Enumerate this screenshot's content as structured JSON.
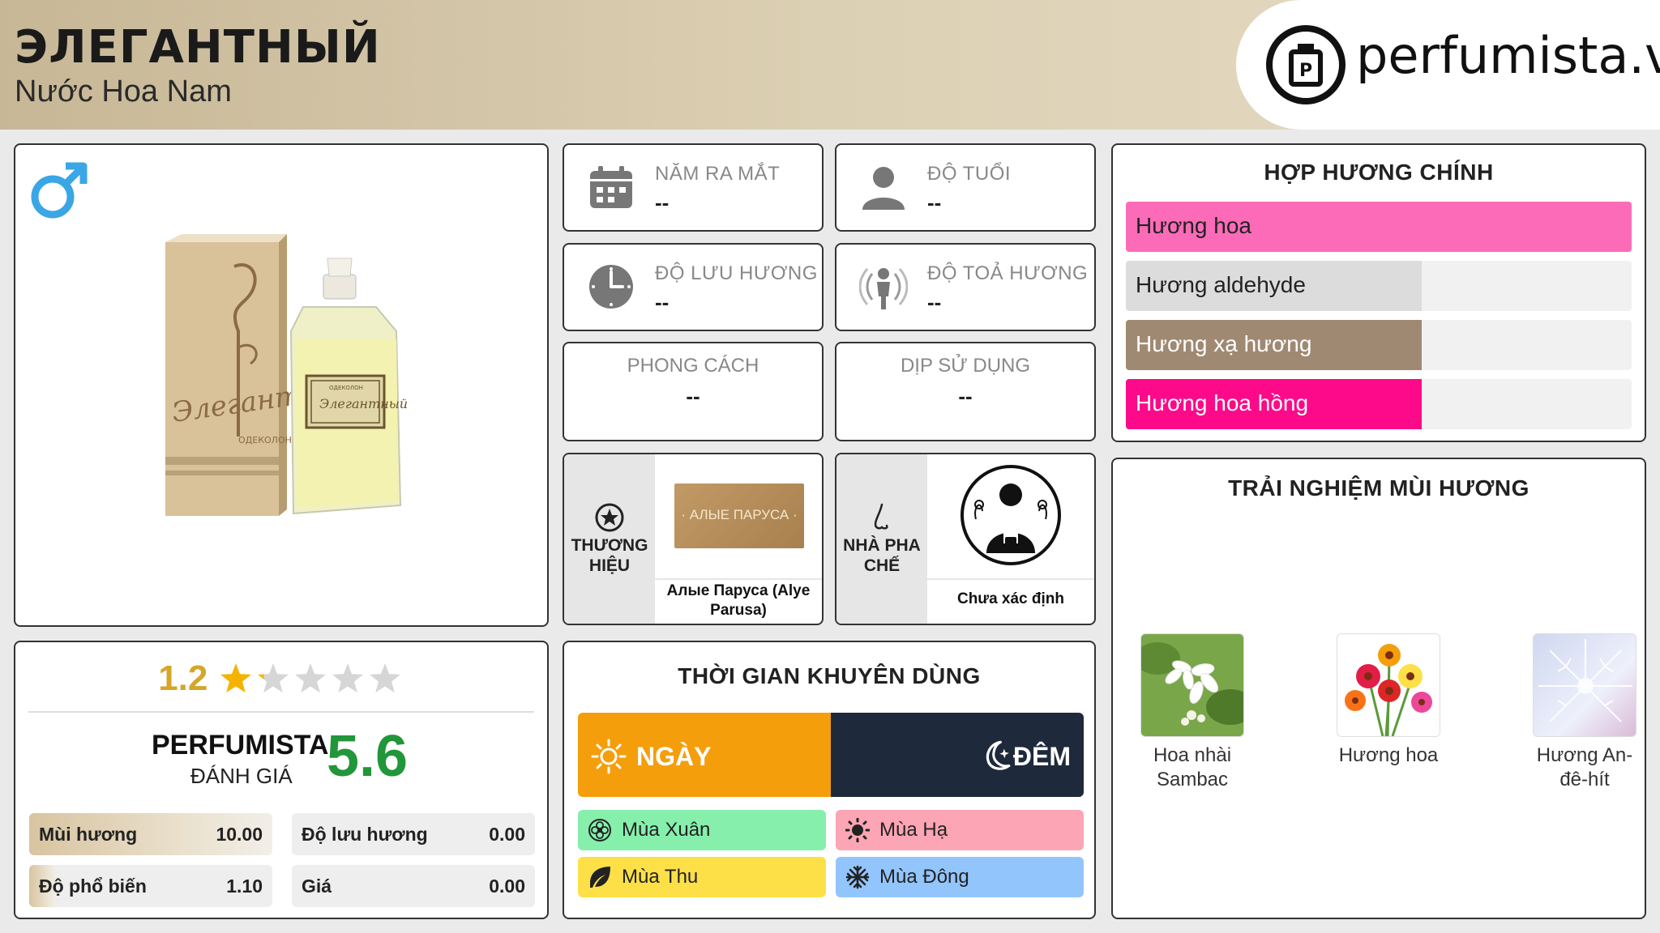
{
  "header": {
    "title": "ЭЛЕГАНТНЫЙ",
    "subtitle": "Nước Hoa Nam",
    "logo_text": "perfumista.vn"
  },
  "product": {
    "box_text": "Элегантный",
    "box_small": "ОДЕКОЛОН",
    "label_text": "Элегантный",
    "label_small": "ОДЕКОЛОН"
  },
  "info": {
    "release": {
      "label": "NĂM RA MẮT",
      "value": "--",
      "icon": "calendar-icon"
    },
    "age": {
      "label": "ĐỘ TUỔI",
      "value": "--",
      "icon": "person-icon"
    },
    "longevity": {
      "label": "ĐỘ LƯU HƯƠNG",
      "value": "--",
      "icon": "clock-icon"
    },
    "sillage": {
      "label": "ĐỘ TOẢ HƯƠNG",
      "value": "--",
      "icon": "sillage-icon"
    },
    "style": {
      "label": "PHONG CÁCH",
      "value": "--"
    },
    "occasion": {
      "label": "DỊP SỬ DỤNG",
      "value": "--"
    },
    "brand": {
      "label_line1": "THƯƠNG",
      "label_line2": "HIỆU",
      "logo_text": "· АЛЫЕ ПАРУСА ·",
      "name": "Алые Паруса (Alye Parusa)"
    },
    "perfumer": {
      "label_line1": "NHÀ PHA",
      "label_line2": "CHẾ",
      "name": "Chưa xác định"
    }
  },
  "accords": {
    "title": "HỢP HƯƠNG CHÍNH",
    "items": [
      {
        "label": "Hương hoa",
        "fill": 1.0,
        "color": "#fc6bb8",
        "text_color": "#222222"
      },
      {
        "label": "Hương aldehyde",
        "fill": 0.585,
        "color": "#dcdcdc",
        "text_color": "#222222"
      },
      {
        "label": "Hương xạ hương",
        "fill": 0.585,
        "color": "#a08972",
        "text_color": "#ffffff"
      },
      {
        "label": "Hương hoa hồng",
        "fill": 0.585,
        "color": "#fc0a8a",
        "text_color": "#ffffff"
      }
    ]
  },
  "notes": {
    "title": "TRẢI NGHIỆM MÙI HƯƠNG",
    "items": [
      {
        "line1": "Hoa nhài",
        "line2": "Sambac"
      },
      {
        "line1": "Hương hoa",
        "line2": ""
      },
      {
        "line1": "Hương An-",
        "line2": "đê-hít"
      }
    ]
  },
  "rating": {
    "score": "1.2",
    "stars_filled": 1.2,
    "stars_total": 5,
    "perfumista_label": "PERFUMISTA",
    "perfumista_sub": "ĐÁNH GIÁ",
    "perfumista_score": "5.6",
    "stats": [
      {
        "label": "Mùi hương",
        "value": "10.00",
        "fill": 1.0
      },
      {
        "label": "Độ lưu hương",
        "value": "0.00",
        "fill": 0.0
      },
      {
        "label": "Độ phổ biến",
        "value": "1.10",
        "fill": 0.11
      },
      {
        "label": "Giá",
        "value": "0.00",
        "fill": 0.0
      }
    ]
  },
  "time": {
    "title": "THỜI GIAN KHUYÊN DÙNG",
    "day_label": "NGÀY",
    "night_label": "ĐÊM",
    "day_color": "#f59e0b",
    "night_color": "#1e293b",
    "seasons": [
      {
        "label": "Mùa Xuân",
        "color": "#86efac",
        "icon": "flower-icon"
      },
      {
        "label": "Mùa Hạ",
        "color": "#fca5b4",
        "icon": "sun-icon"
      },
      {
        "label": "Mùa Thu",
        "color": "#fde047",
        "icon": "leaf-icon"
      },
      {
        "label": "Mùa Đông",
        "color": "#93c5fd",
        "icon": "snowflake-icon"
      }
    ]
  }
}
